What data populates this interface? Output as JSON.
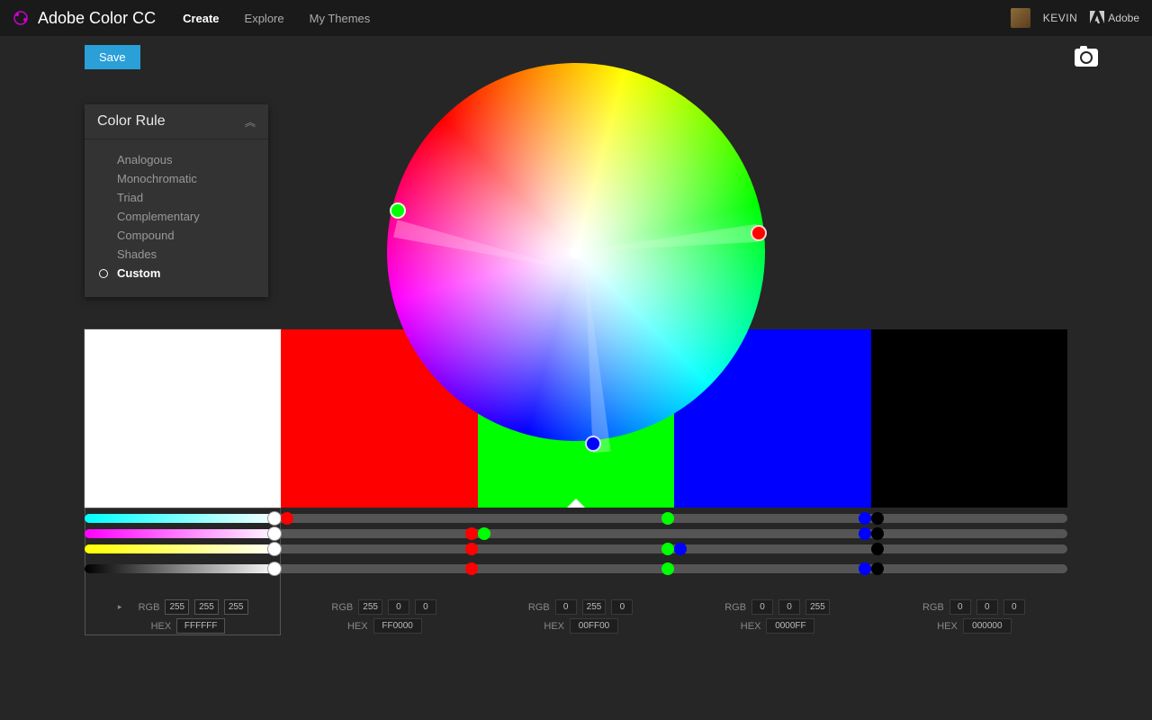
{
  "app": {
    "title": "Adobe Color CC",
    "user": "KEVIN",
    "adobe_label": "Adobe"
  },
  "nav": {
    "create": "Create",
    "explore": "Explore",
    "mythemes": "My Themes",
    "active": "create"
  },
  "actions": {
    "save": "Save"
  },
  "rule_panel": {
    "title": "Color Rule",
    "items": [
      {
        "label": "Analogous",
        "selected": false
      },
      {
        "label": "Monochromatic",
        "selected": false
      },
      {
        "label": "Triad",
        "selected": false
      },
      {
        "label": "Complementary",
        "selected": false
      },
      {
        "label": "Compound",
        "selected": false
      },
      {
        "label": "Shades",
        "selected": false
      },
      {
        "label": "Custom",
        "selected": true
      }
    ]
  },
  "wheel": {
    "handles": [
      {
        "angle": 167,
        "radius": 0.97,
        "color": "#00FF00"
      },
      {
        "angle": 6,
        "radius": 0.97,
        "color": "#FF0000"
      },
      {
        "angle": 275,
        "radius": 1.02,
        "color": "#0000FF"
      }
    ]
  },
  "swatches": [
    {
      "color": "#FFFFFF",
      "active": true,
      "rgb": [
        255,
        255,
        255
      ],
      "hex": "FFFFFF"
    },
    {
      "color": "#FF0000",
      "active": false,
      "rgb": [
        255,
        0,
        0
      ],
      "hex": "FF0000"
    },
    {
      "color": "#00FF00",
      "active": false,
      "rgb": [
        0,
        255,
        0
      ],
      "hex": "00FF00",
      "caret": true
    },
    {
      "color": "#0000FF",
      "active": false,
      "rgb": [
        0,
        0,
        255
      ],
      "hex": "0000FF"
    },
    {
      "color": "#000000",
      "active": false,
      "rgb": [
        0,
        0,
        0
      ],
      "hex": "000000"
    }
  ],
  "sliders": {
    "rows": [
      {
        "fill": "linear-gradient(90deg,#00ffff,#ffffff)"
      },
      {
        "fill": "linear-gradient(90deg,#ff00ff,#ffffff)"
      },
      {
        "fill": "linear-gradient(90deg,#ffff00,#ffffff)"
      },
      {
        "fill": "linear-gradient(90deg,#000000,#888888,#ffffff)"
      }
    ],
    "columns": [
      {
        "dotcolor": "#FFFFFF",
        "positions": [
          1.0,
          1.0,
          1.0,
          1.0
        ],
        "gradient": true
      },
      {
        "dotcolor": "#FF0000",
        "positions": [
          0.0,
          1.0,
          1.0,
          1.0
        ]
      },
      {
        "dotcolor": "#00FF00",
        "positions": [
          1.0,
          0.0,
          1.0,
          1.0
        ]
      },
      {
        "dotcolor": "#0000FF",
        "positions": [
          1.0,
          1.0,
          0.0,
          1.0
        ]
      },
      {
        "dotcolor": "#000000",
        "positions": [
          0.0,
          0.0,
          0.0,
          0.0
        ]
      }
    ]
  },
  "value_labels": {
    "rgb": "RGB",
    "hex": "HEX"
  }
}
